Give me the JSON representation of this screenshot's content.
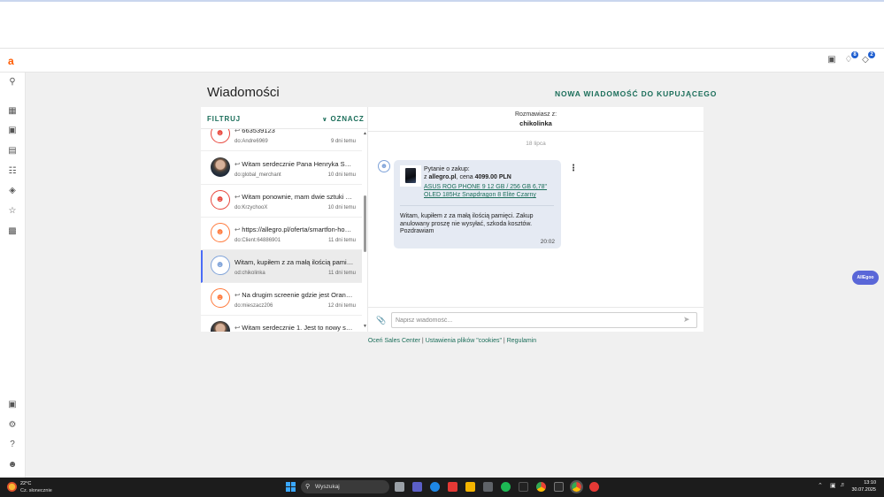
{
  "app": {
    "logo": "a",
    "notifications_badge": "8",
    "alerts_badge": "2"
  },
  "page": {
    "title": "Wiadomości",
    "new_message_button": "NOWA WIADOMOŚĆ DO KUPUJĄCEGO"
  },
  "list": {
    "filter_label": "FILTRUJ",
    "mark_label": "OZNACZ",
    "conversations": [
      {
        "title": "663539123",
        "sub": "do:Andre6969",
        "date": "9 dni temu",
        "avatar": "red",
        "reply": true
      },
      {
        "title": "Witam serdecznie Pana Henryka Sam s...",
        "sub": "do:global_merchant",
        "date": "10 dni temu",
        "avatar": "photo",
        "reply": true
      },
      {
        "title": "Witam ponownie, mam dwie sztuki dost...",
        "sub": "do:KrzychooX",
        "date": "10 dni temu",
        "avatar": "red",
        "reply": true
      },
      {
        "title": "https://allegro.pl/oferta/smartfon-hono...",
        "sub": "do:Client:64886901",
        "date": "11 dni temu",
        "avatar": "orange",
        "reply": true
      },
      {
        "title": "Witam, kupiłem z za małą ilością pamięc...",
        "sub": "od:chikolinka",
        "date": "11 dni temu",
        "avatar": "blue",
        "reply": false,
        "active": true
      },
      {
        "title": "Na drugim screenie gdzie jest Orange, t...",
        "sub": "do:mieszacz206",
        "date": "12 dni temu",
        "avatar": "orange",
        "reply": true
      },
      {
        "title": "Witam serdecznie 1. Jest to nowy smartf...",
        "sub": "",
        "date": "",
        "avatar": "photo",
        "reply": true
      }
    ]
  },
  "chat": {
    "with_label": "Rozmawiasz z:",
    "with_name": "chikolinka",
    "date_separator": "18 lipca",
    "product_question": "Pytanie o zakup:",
    "product_from_prefix": "z",
    "product_site": "allegro.pl",
    "product_price_prefix": ", cena",
    "product_price": "4099.00 PLN",
    "product_link": "ASUS ROG PHONE 9 12 GB / 256 GB 6,78\" OLED 185Hz Snapdragon 8 Elite Czarny",
    "message_text": "Witam, kupiłem z za małą ilością pamięci. Zakup anulowany proszę nie wysyłać, szkoda kosztów. Pozdrawiam",
    "message_time": "20:02",
    "input_placeholder": "Napisz wiadomość..."
  },
  "footer": {
    "link1": "Oceń Sales Center",
    "sep": " | ",
    "link2": "Ustawienia plików \"cookies\"",
    "link3": "Regulamin"
  },
  "floating": {
    "pill_label": "AllEgoo"
  },
  "taskbar": {
    "temp": "22°C",
    "weather": "Cz. słonecznie",
    "search_placeholder": "Wyszukaj",
    "time": "13:10",
    "date": "30.07.2025"
  }
}
